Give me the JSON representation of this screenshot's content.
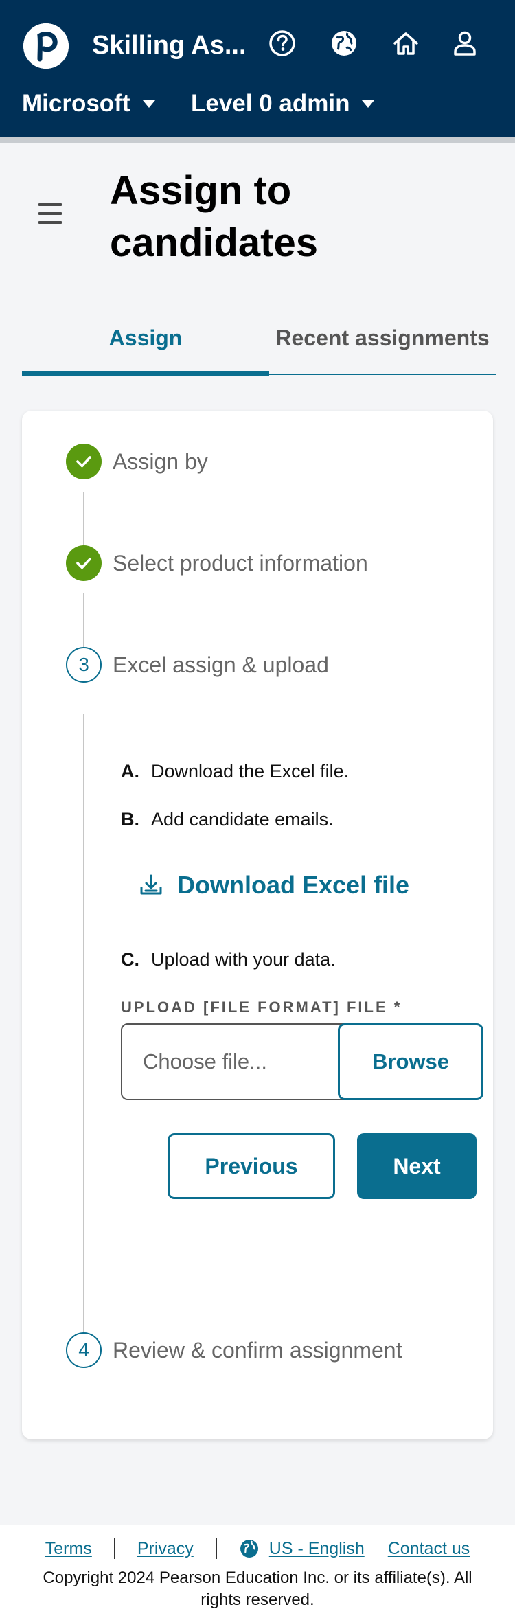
{
  "header": {
    "app_title": "Skilling As...",
    "org_select": "Microsoft",
    "role_select": "Level 0 admin",
    "icons": [
      "help-icon",
      "globe-icon",
      "home-icon",
      "user-icon"
    ],
    "bg_color": "#003057"
  },
  "page": {
    "title": "Assign to candidates"
  },
  "tabs": [
    {
      "label": "Assign",
      "active": true
    },
    {
      "label": "Recent assignments",
      "active": false
    }
  ],
  "steps": [
    {
      "number": "1",
      "label": "Assign by",
      "status": "complete"
    },
    {
      "number": "2",
      "label": "Select product information",
      "status": "complete"
    },
    {
      "number": "3",
      "label": "Excel assign & upload",
      "status": "current"
    },
    {
      "number": "4",
      "label": "Review & confirm assignment",
      "status": "pending"
    }
  ],
  "instructions": [
    {
      "letter": "A.",
      "text": "Download the Excel file."
    },
    {
      "letter": "B.",
      "text": "Add candidate emails."
    },
    {
      "letter": "C.",
      "text": "Upload with your data."
    }
  ],
  "download_link": "Download Excel file",
  "upload": {
    "label": "UPLOAD [FILE FORMAT] FILE *",
    "placeholder": "Choose file...",
    "browse_label": "Browse"
  },
  "buttons": {
    "previous": "Previous",
    "next": "Next"
  },
  "footer": {
    "terms": "Terms",
    "privacy": "Privacy",
    "language": "US - English",
    "contact": "Contact us",
    "copyright": "Copyright 2024 Pearson Education Inc. or its affiliate(s). All rights reserved."
  },
  "colors": {
    "accent": "#0a6e8f",
    "complete": "#5a9a10"
  }
}
